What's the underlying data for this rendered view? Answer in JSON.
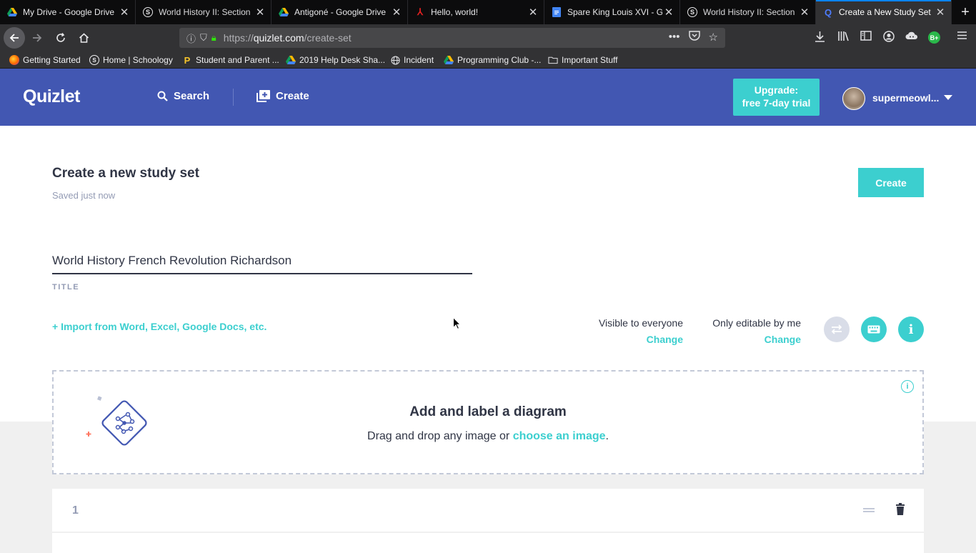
{
  "browser": {
    "tabs": [
      {
        "title": "My Drive - Google Drive",
        "icon": "google-drive-icon"
      },
      {
        "title": "World History II: Section",
        "icon": "schoology-icon"
      },
      {
        "title": "Antigoné - Google Drive",
        "icon": "google-drive-icon"
      },
      {
        "title": "Hello, world!",
        "icon": "red-figure-icon"
      },
      {
        "title": "Spare King Louis XVI - G",
        "icon": "google-docs-icon"
      },
      {
        "title": "World History II: Section",
        "icon": "schoology-icon"
      },
      {
        "title": "Create a New Study Set |",
        "icon": "quizlet-icon",
        "active": true
      }
    ],
    "url_prefix": "https://",
    "url_domain": "quizlet.com",
    "url_path": "/create-set",
    "bookmarks": [
      {
        "label": "Getting Started",
        "icon": "firefox-icon"
      },
      {
        "label": "Home | Schoology",
        "icon": "schoology-icon"
      },
      {
        "label": "Student and Parent ...",
        "icon": "powerschool-icon"
      },
      {
        "label": "2019 Help Desk Sha...",
        "icon": "google-drive-icon"
      },
      {
        "label": "Incident",
        "icon": "globe-icon"
      },
      {
        "label": "Programming Club -...",
        "icon": "google-drive-icon"
      },
      {
        "label": "Important Stuff",
        "icon": "folder-icon"
      }
    ],
    "extension_badge": "B+"
  },
  "header": {
    "logo": "Quizlet",
    "search_label": "Search",
    "create_label": "Create",
    "upgrade_line1": "Upgrade:",
    "upgrade_line2": "free 7-day trial",
    "username": "supermeowl..."
  },
  "main": {
    "page_title": "Create a new study set",
    "saved_status": "Saved just now",
    "create_button": "Create",
    "title_value": "World History French Revolution Richardson",
    "title_label": "TITLE",
    "import_link": "+ Import from Word, Excel, Google Docs, etc.",
    "visibility_label": "Visible to everyone",
    "visibility_change": "Change",
    "editable_label": "Only editable by me",
    "editable_change": "Change",
    "diagram": {
      "title": "Add and label a diagram",
      "subtitle_prefix": "Drag and drop any image or ",
      "subtitle_link": "choose an image",
      "subtitle_suffix": "."
    },
    "cards": [
      {
        "number": "1"
      }
    ]
  },
  "colors": {
    "quizlet_blue": "#4257b2",
    "accent_teal": "#3ccfcf",
    "text_dark": "#303545",
    "text_muted": "#939bb4"
  }
}
